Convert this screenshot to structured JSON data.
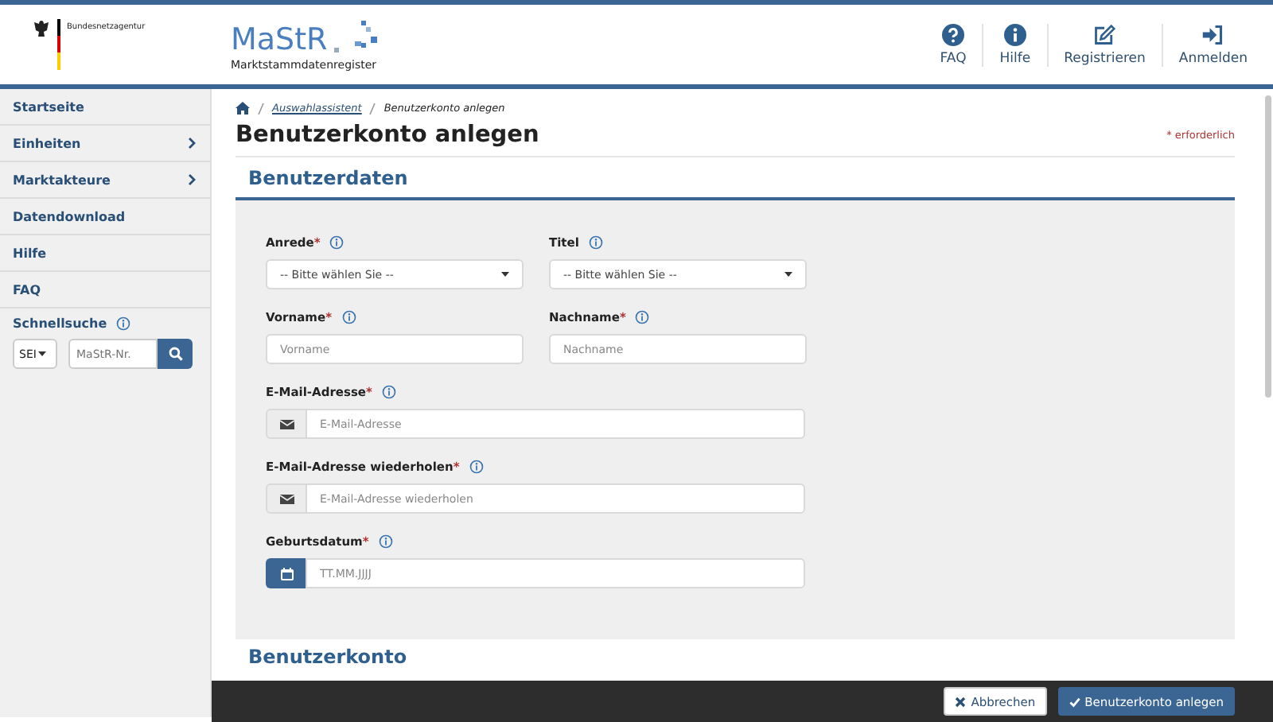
{
  "header": {
    "agency": "Bundesnetzagentur",
    "logo_title": "MaStR",
    "logo_subtitle": "Marktstammdatenregister",
    "nav": [
      {
        "label": "FAQ",
        "kind": "question"
      },
      {
        "label": "Hilfe",
        "kind": "info"
      },
      {
        "label": "Registrieren",
        "kind": "edit"
      },
      {
        "label": "Anmelden",
        "kind": "login"
      }
    ]
  },
  "sidebar": {
    "items": [
      {
        "label": "Startseite",
        "expandable": false
      },
      {
        "label": "Einheiten",
        "expandable": true
      },
      {
        "label": "Marktakteure",
        "expandable": true
      },
      {
        "label": "Datendownload",
        "expandable": false
      },
      {
        "label": "Hilfe",
        "expandable": false
      },
      {
        "label": "FAQ",
        "expandable": false
      }
    ],
    "quick_search": {
      "label": "Schnellsuche",
      "type_value": "SEI",
      "placeholder": "MaStR-Nr."
    }
  },
  "breadcrumb": [
    "Auswahlassistent",
    "Benutzerkonto anlegen"
  ],
  "title": "Benutzerkonto anlegen",
  "required_note": "* erforderlich",
  "section": "Benutzerdaten",
  "fields": [
    {
      "label": "Anrede",
      "required_mark": "*",
      "kind": "select",
      "placeholder": "-- Bitte wählen Sie --"
    },
    {
      "label": "Titel",
      "kind": "select",
      "placeholder": "-- Bitte wählen Sie --"
    },
    {
      "label": "Vorname",
      "required_mark": "*",
      "kind": "text",
      "placeholder": "Vorname"
    },
    {
      "label": "Nachname",
      "required_mark": "*",
      "kind": "text",
      "placeholder": "Nachname"
    },
    {
      "label": "E-Mail-Adresse",
      "required_mark": "*",
      "kind": "email",
      "placeholder": "E-Mail-Adresse"
    },
    {
      "label": "E-Mail-Adresse wiederholen",
      "required_mark": "*",
      "kind": "email",
      "placeholder": "E-Mail-Adresse wiederholen"
    },
    {
      "label": "Geburtsdatum",
      "required_mark": "*",
      "kind": "date",
      "placeholder": "TT.MM.JJJJ"
    }
  ],
  "next_section": "Benutzerkonto",
  "actions": [
    {
      "label": "Abbrechen",
      "kind": "cancel"
    },
    {
      "label": "Benutzerkonto anlegen",
      "kind": "submit"
    }
  ]
}
